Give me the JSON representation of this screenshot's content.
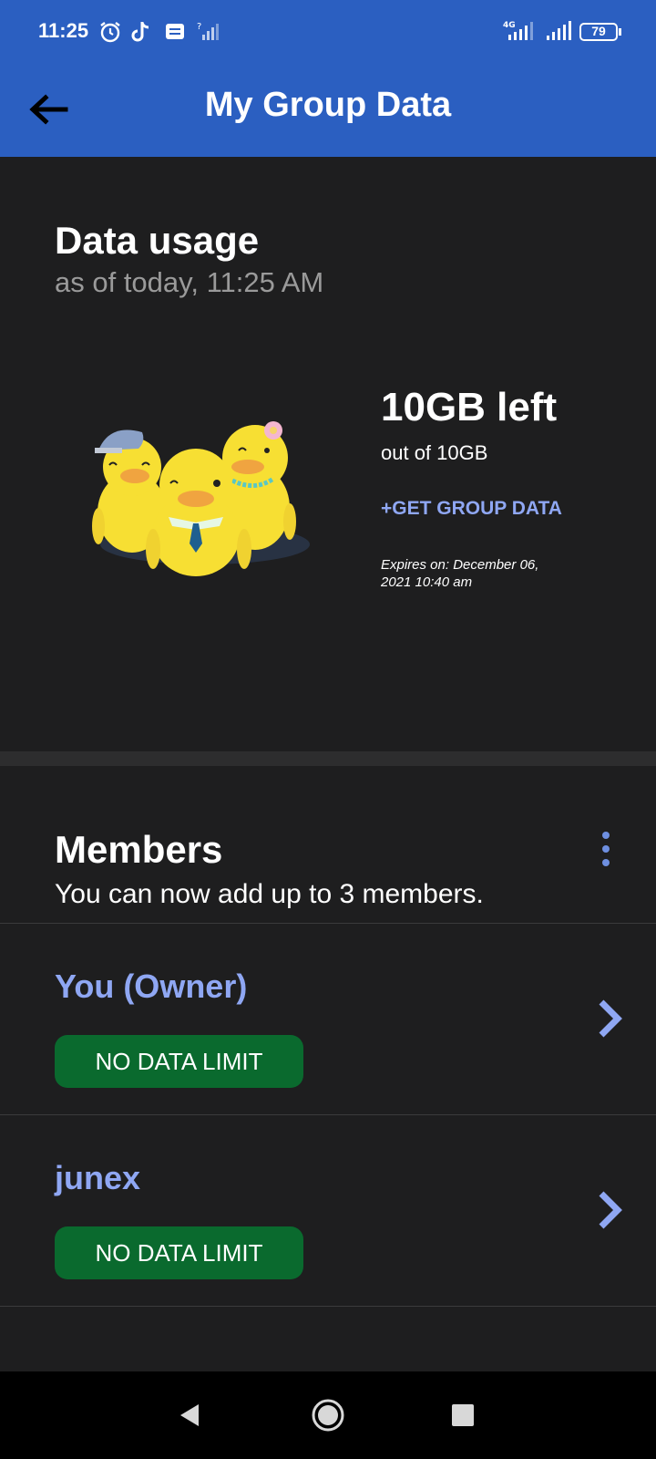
{
  "status_bar": {
    "time": "11:25",
    "network_label": "4G",
    "battery": "79"
  },
  "app_bar": {
    "title": "My Group Data"
  },
  "usage": {
    "heading": "Data usage",
    "as_of": "as of today, 11:25 AM",
    "left_amount": "10GB left",
    "total": "out of 10GB",
    "get_data_label": "+GET GROUP DATA",
    "expires": "Expires on: December 06, 2021 10:40 am"
  },
  "members": {
    "heading": "Members",
    "subtitle": "You can now add up to 3 members.",
    "items": [
      {
        "name": "You (Owner)",
        "limit": "NO DATA LIMIT"
      },
      {
        "name": "junex",
        "limit": "NO DATA LIMIT"
      }
    ]
  },
  "colors": {
    "brand_blue": "#2b5fc1",
    "accent_link": "#8fa7f3",
    "badge_green": "#0a6a2e",
    "background": "#1e1e1f"
  }
}
